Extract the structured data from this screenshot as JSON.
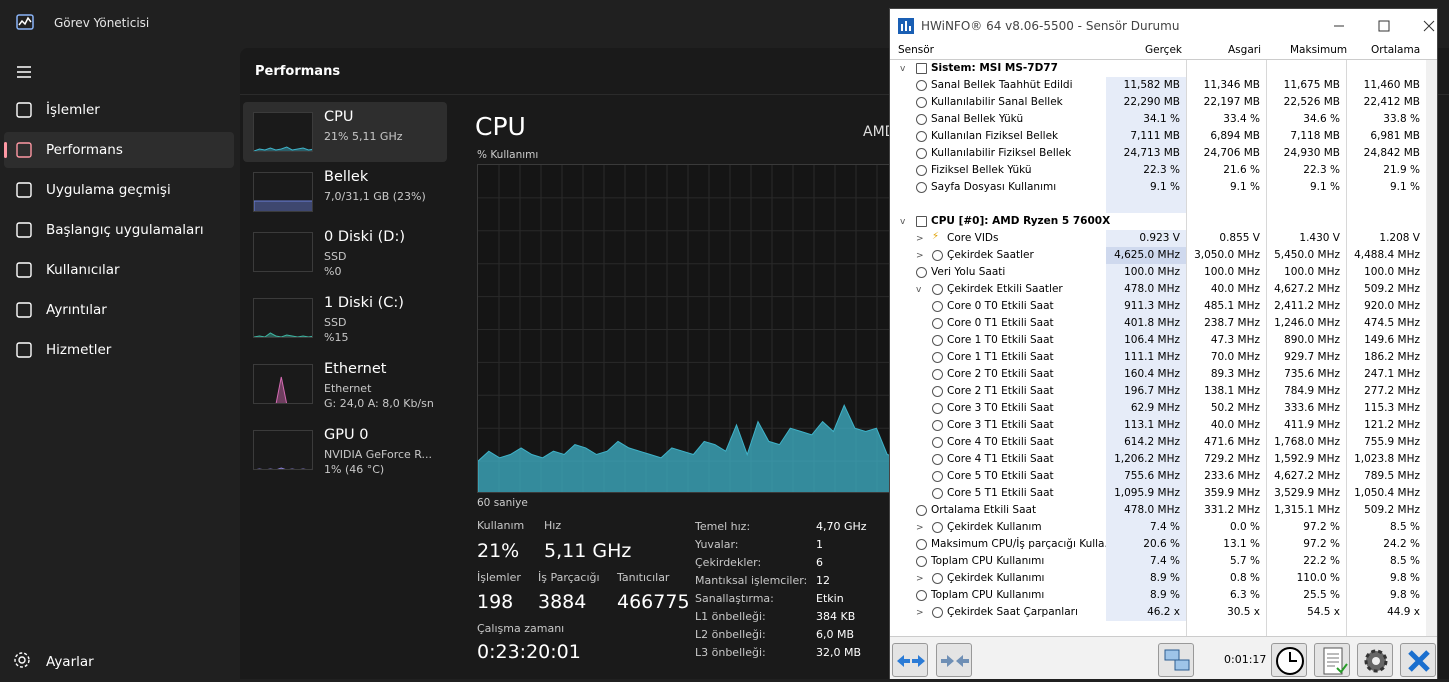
{
  "taskmgr": {
    "title": "Görev Yöneticisi",
    "nav": [
      {
        "label": "İşlemler",
        "icon": "processes-icon"
      },
      {
        "label": "Performans",
        "icon": "performance-icon",
        "active": true
      },
      {
        "label": "Uygulama geçmişi",
        "icon": "app-history-icon"
      },
      {
        "label": "Başlangıç uygulamaları",
        "icon": "startup-apps-icon"
      },
      {
        "label": "Kullanıcılar",
        "icon": "users-icon"
      },
      {
        "label": "Ayrıntılar",
        "icon": "details-icon"
      },
      {
        "label": "Hizmetler",
        "icon": "services-icon"
      }
    ],
    "settings_label": "Ayarlar",
    "page_title": "Performans",
    "resources": [
      {
        "name": "CPU",
        "line1": "21%  5,11 GHz",
        "line2": ""
      },
      {
        "name": "Bellek",
        "line1": "7,0/31,1 GB (23%)",
        "line2": ""
      },
      {
        "name": "0 Diski (D:)",
        "line1": "SSD",
        "line2": "%0"
      },
      {
        "name": "1 Diski (C:)",
        "line1": "SSD",
        "line2": "%15"
      },
      {
        "name": "Ethernet",
        "line1": "Ethernet",
        "line2": "G: 24,0  A: 8,0 Kb/sn"
      },
      {
        "name": "GPU 0",
        "line1": "NVIDIA GeForce R...",
        "line2": "1% (46 °C)"
      }
    ],
    "cpu": {
      "title": "CPU",
      "model": "AMD",
      "ylabel": "% Kullanımı",
      "xlabel": "60 saniye",
      "kullanim_label": "Kullanım",
      "kullanim": "21%",
      "hiz_label": "Hız",
      "hiz": "5,11 GHz",
      "islemler_label": "İşlemler",
      "islemler": "198",
      "is_parcacigi_label": "İş Parçacığı",
      "is_parcacigi": "3884",
      "taniticilar_label": "Tanıtıcılar",
      "taniticilar": "466775",
      "calisma_label": "Çalışma zamanı",
      "calisma": "0:23:20:01",
      "details": [
        {
          "label": "Temel hız:",
          "value": "4,70 GHz"
        },
        {
          "label": "Yuvalar:",
          "value": "1"
        },
        {
          "label": "Çekirdekler:",
          "value": "6"
        },
        {
          "label": "Mantıksal işlemciler:",
          "value": "12"
        },
        {
          "label": "Sanallaştırma:",
          "value": "Etkin"
        },
        {
          "label": "L1 önbelleği:",
          "value": "384 KB"
        },
        {
          "label": "L2 önbelleği:",
          "value": "6,0 MB"
        },
        {
          "label": "L3 önbelleği:",
          "value": "32,0 MB"
        }
      ],
      "usage_history": [
        10,
        13,
        11,
        12,
        14,
        12,
        11,
        13,
        12,
        15,
        14,
        12,
        13,
        16,
        14,
        13,
        12,
        11,
        14,
        13,
        12,
        16,
        15,
        13,
        21,
        12,
        22,
        16,
        15,
        20,
        19,
        18,
        22,
        19,
        27,
        20,
        19,
        20,
        12,
        11
      ],
      "accent": "#3fb3c9"
    }
  },
  "hwinfo": {
    "title": "HWiNFO® 64 v8.06-5500 - Sensör Durumu",
    "columns": [
      "Sensör",
      "Gerçek",
      "Asgari",
      "Maksimum",
      "Ortalama"
    ],
    "timer": "0:01:17",
    "rows": [
      {
        "type": "group",
        "label": "Sistem: MSI MS-7D77"
      },
      {
        "label": "Sanal Bellek Taahhüt Edildi",
        "v": [
          "11,582 MB",
          "11,346 MB",
          "11,675 MB",
          "11,460 MB"
        ],
        "indent": 1
      },
      {
        "label": "Kullanılabilir Sanal Bellek",
        "v": [
          "22,290 MB",
          "22,197 MB",
          "22,526 MB",
          "22,412 MB"
        ],
        "indent": 1
      },
      {
        "label": "Sanal Bellek Yükü",
        "v": [
          "34.1 %",
          "33.4 %",
          "34.6 %",
          "33.8 %"
        ],
        "indent": 1
      },
      {
        "label": "Kullanılan Fiziksel Bellek",
        "v": [
          "7,111 MB",
          "6,894 MB",
          "7,118 MB",
          "6,981 MB"
        ],
        "indent": 1
      },
      {
        "label": "Kullanılabilir Fiziksel Bellek",
        "v": [
          "24,713 MB",
          "24,706 MB",
          "24,930 MB",
          "24,842 MB"
        ],
        "indent": 1
      },
      {
        "label": "Fiziksel Bellek Yükü",
        "v": [
          "22.3 %",
          "21.6 %",
          "22.3 %",
          "21.9 %"
        ],
        "indent": 1
      },
      {
        "label": "Sayfa Dosyası Kullanımı",
        "v": [
          "9.1 %",
          "9.1 %",
          "9.1 %",
          "9.1 %"
        ],
        "indent": 1
      },
      {
        "type": "blank"
      },
      {
        "type": "group",
        "label": "CPU [#0]: AMD Ryzen 5 7600X"
      },
      {
        "label": "Core VIDs",
        "v": [
          "0.923 V",
          "0.855 V",
          "1.430 V",
          "1.208 V"
        ],
        "indent": 2,
        "tw": ">",
        "bolt": true
      },
      {
        "label": "Çekirdek Saatler",
        "v": [
          "4,625.0 MHz",
          "3,050.0 MHz",
          "5,450.0 MHz",
          "4,488.4 MHz"
        ],
        "indent": 2,
        "tw": ">",
        "sel": true
      },
      {
        "label": "Veri Yolu Saati",
        "v": [
          "100.0 MHz",
          "100.0 MHz",
          "100.0 MHz",
          "100.0 MHz"
        ],
        "indent": 1
      },
      {
        "label": "Çekirdek Etkili Saatler",
        "v": [
          "478.0 MHz",
          "40.0 MHz",
          "4,627.2 MHz",
          "509.2 MHz"
        ],
        "indent": 2,
        "tw": "v"
      },
      {
        "label": "Core 0 T0 Etkili Saat",
        "v": [
          "911.3 MHz",
          "485.1 MHz",
          "2,411.2 MHz",
          "920.0 MHz"
        ],
        "indent": 3
      },
      {
        "label": "Core 0 T1 Etkili Saat",
        "v": [
          "401.8 MHz",
          "238.7 MHz",
          "1,246.0 MHz",
          "474.5 MHz"
        ],
        "indent": 3
      },
      {
        "label": "Core 1 T0 Etkili Saat",
        "v": [
          "106.4 MHz",
          "47.3 MHz",
          "890.0 MHz",
          "149.6 MHz"
        ],
        "indent": 3
      },
      {
        "label": "Core 1 T1 Etkili Saat",
        "v": [
          "111.1 MHz",
          "70.0 MHz",
          "929.7 MHz",
          "186.2 MHz"
        ],
        "indent": 3
      },
      {
        "label": "Core 2 T0 Etkili Saat",
        "v": [
          "160.4 MHz",
          "89.3 MHz",
          "735.6 MHz",
          "247.1 MHz"
        ],
        "indent": 3
      },
      {
        "label": "Core 2 T1 Etkili Saat",
        "v": [
          "196.7 MHz",
          "138.1 MHz",
          "784.9 MHz",
          "277.2 MHz"
        ],
        "indent": 3
      },
      {
        "label": "Core 3 T0 Etkili Saat",
        "v": [
          "62.9 MHz",
          "50.2 MHz",
          "333.6 MHz",
          "115.3 MHz"
        ],
        "indent": 3
      },
      {
        "label": "Core 3 T1 Etkili Saat",
        "v": [
          "113.1 MHz",
          "40.0 MHz",
          "411.9 MHz",
          "121.2 MHz"
        ],
        "indent": 3
      },
      {
        "label": "Core 4 T0 Etkili Saat",
        "v": [
          "614.2 MHz",
          "471.6 MHz",
          "1,768.0 MHz",
          "755.9 MHz"
        ],
        "indent": 3
      },
      {
        "label": "Core 4 T1 Etkili Saat",
        "v": [
          "1,206.2 MHz",
          "729.2 MHz",
          "1,592.9 MHz",
          "1,023.8 MHz"
        ],
        "indent": 3
      },
      {
        "label": "Core 5 T0 Etkili Saat",
        "v": [
          "755.6 MHz",
          "233.6 MHz",
          "4,627.2 MHz",
          "789.5 MHz"
        ],
        "indent": 3
      },
      {
        "label": "Core 5 T1 Etkili Saat",
        "v": [
          "1,095.9 MHz",
          "359.9 MHz",
          "3,529.9 MHz",
          "1,050.4 MHz"
        ],
        "indent": 3
      },
      {
        "label": "Ortalama Etkili Saat",
        "v": [
          "478.0 MHz",
          "331.2 MHz",
          "1,315.1 MHz",
          "509.2 MHz"
        ],
        "indent": 1
      },
      {
        "label": "Çekirdek Kullanım",
        "v": [
          "7.4 %",
          "0.0 %",
          "97.2 %",
          "8.5 %"
        ],
        "indent": 2,
        "tw": ">"
      },
      {
        "label": "Maksimum CPU/İş parçacığı Kulla...",
        "v": [
          "20.6 %",
          "13.1 %",
          "97.2 %",
          "24.2 %"
        ],
        "indent": 1
      },
      {
        "label": "Toplam CPU Kullanımı",
        "v": [
          "7.4 %",
          "5.7 %",
          "22.2 %",
          "8.5 %"
        ],
        "indent": 1
      },
      {
        "label": "Çekirdek Kullanımı",
        "v": [
          "8.9 %",
          "0.8 %",
          "110.0 %",
          "9.8 %"
        ],
        "indent": 2,
        "tw": ">"
      },
      {
        "label": "Toplam CPU Kullanımı",
        "v": [
          "8.9 %",
          "6.3 %",
          "25.5 %",
          "9.8 %"
        ],
        "indent": 1
      },
      {
        "label": "Çekirdek Saat Çarpanları",
        "v": [
          "46.2 x",
          "30.5 x",
          "54.5 x",
          "44.9 x"
        ],
        "indent": 2,
        "tw": ">"
      }
    ]
  }
}
